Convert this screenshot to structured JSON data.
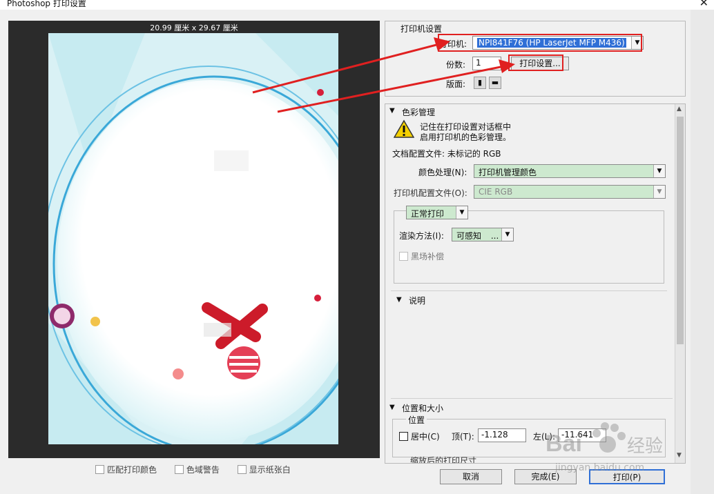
{
  "window": {
    "title": "Photoshop 打印设置"
  },
  "preview": {
    "paper_size": "20.99 厘米 x 29.67 厘米"
  },
  "bottom_checks": [
    "匹配打印颜色",
    "色域警告",
    "显示纸张白"
  ],
  "printer_setup": {
    "heading": "打印机设置",
    "printer_label": "打印机:",
    "printer_value": "NPI841F76 (HP LaserJet MFP M436)",
    "copies_label": "份数:",
    "copies_value": "1",
    "print_settings_btn": "打印设置...",
    "layout_label": "版面:"
  },
  "color_mgmt": {
    "heading": "色彩管理",
    "warning_line1": "记住在打印设置对话框中",
    "warning_line2": "启用打印机的色彩管理。",
    "doc_profile": "文档配置文件: 未标记的 RGB",
    "handling_label": "颜色处理(N):",
    "handling_value": "打印机管理颜色",
    "printer_profile_label": "打印机配置文件(O):",
    "printer_profile_value": "CIE RGB",
    "normal_print": "正常打印",
    "render_label": "渲染方法(I):",
    "render_value": "可感知",
    "render_ellipsis": "...",
    "blackpoint": "黑场补偿"
  },
  "description": {
    "heading": "说明"
  },
  "position": {
    "heading": "位置和大小",
    "group": "位置",
    "center_label": "居中(C)",
    "top_label": "顶(T):",
    "top_value": "-1.128",
    "left_label": "左(L):",
    "left_value": "-11.641",
    "next_heading": "缩放后的打印尺寸"
  },
  "footer": {
    "cancel": "取消",
    "done": "完成(E)",
    "print": "打印(P)"
  },
  "watermark": {
    "brand": "Bai",
    "brand2": "经验",
    "url": "jingyan.baidu.com"
  },
  "colors": {
    "accent_red": "#e02020",
    "selection_blue": "#2f6fd6",
    "select_green": "#cde9cf"
  }
}
